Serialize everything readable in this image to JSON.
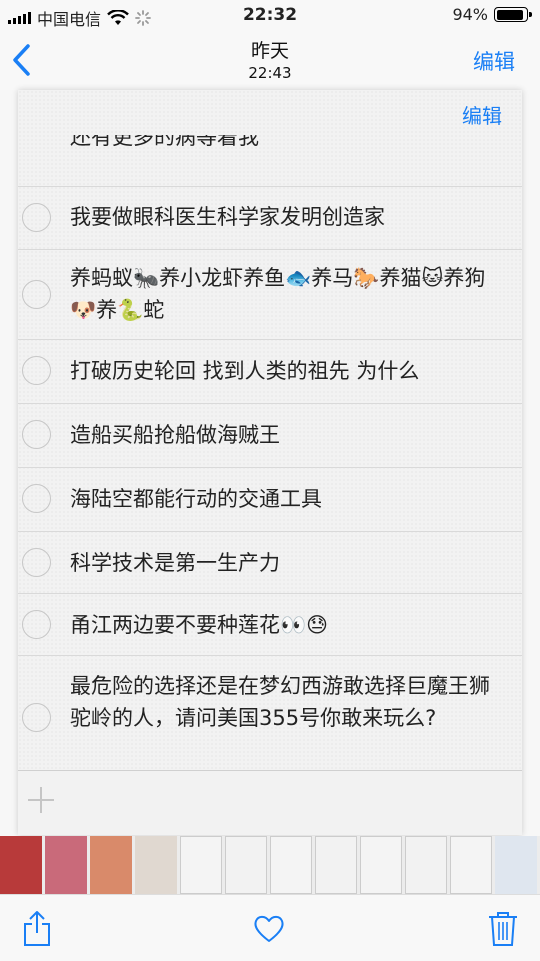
{
  "status": {
    "carrier": "中国电信",
    "time": "22:32",
    "battery_text": "94%",
    "battery_level": 0.94,
    "icons": [
      "signal-icon",
      "wifi-icon",
      "activity-spinner-icon",
      "battery-icon"
    ]
  },
  "nav": {
    "title": "昨天",
    "subtitle": "22:43",
    "edit_label": "编辑",
    "accent": "#1a7ff5"
  },
  "note": {
    "edit_label": "编辑",
    "partial_top": "还有更多的病等着我",
    "items": [
      {
        "text": "我要做眼科医生科学家发明创造家"
      },
      {
        "text": "养蚂蚁🐜养小龙虾养鱼🐟养马🐎养猫🐱养狗🐶养🐍蛇"
      },
      {
        "text": "打破历史轮回 找到人类的祖先 为什么"
      },
      {
        "text": "造船买船抢船做海贼王"
      },
      {
        "text": "海陆空都能行动的交通工具"
      },
      {
        "text": "科学技术是第一生产力"
      },
      {
        "text": "甬江两边要不要种莲花👀😓"
      },
      {
        "text": "最危险的选择还是在梦幻西游敢选择巨魔王狮驼岭的人，请问美国355号你敢来玩么?"
      }
    ],
    "add_icon": "plus-icon"
  },
  "toolbar": {
    "icons": [
      "share-icon",
      "heart-icon",
      "trash-icon"
    ]
  }
}
